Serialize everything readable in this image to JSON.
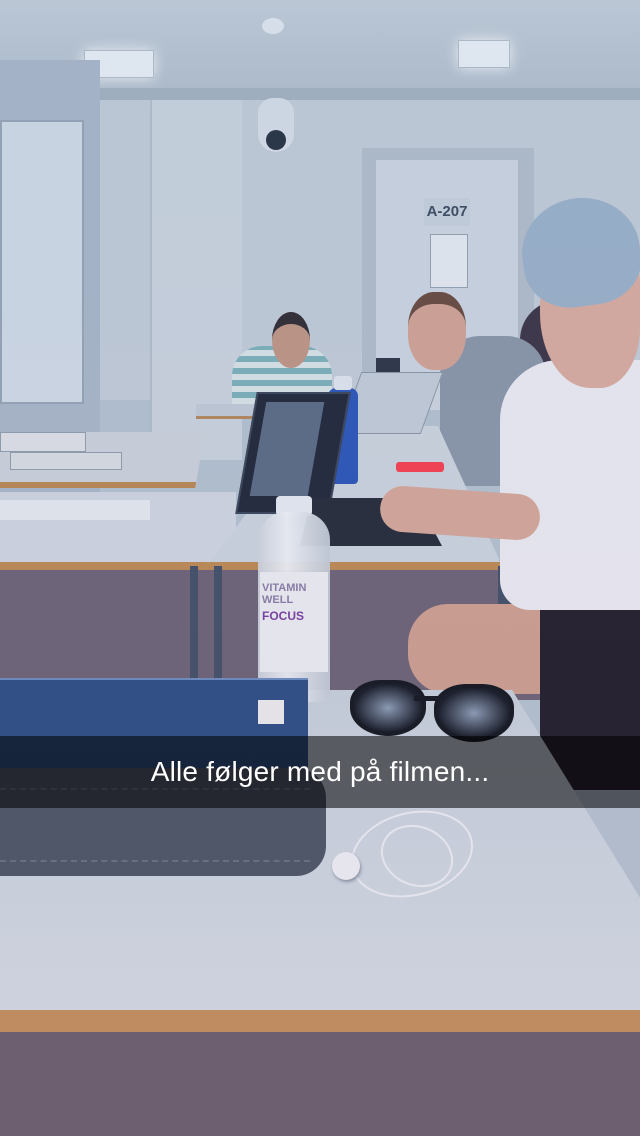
{
  "caption": {
    "text": "Alle følger med på filmen..."
  },
  "room": {
    "door_label": "A-207"
  },
  "bottle": {
    "brand_line1": "VITAMIN",
    "brand_line2": "WELL",
    "product": "FOCUS"
  }
}
